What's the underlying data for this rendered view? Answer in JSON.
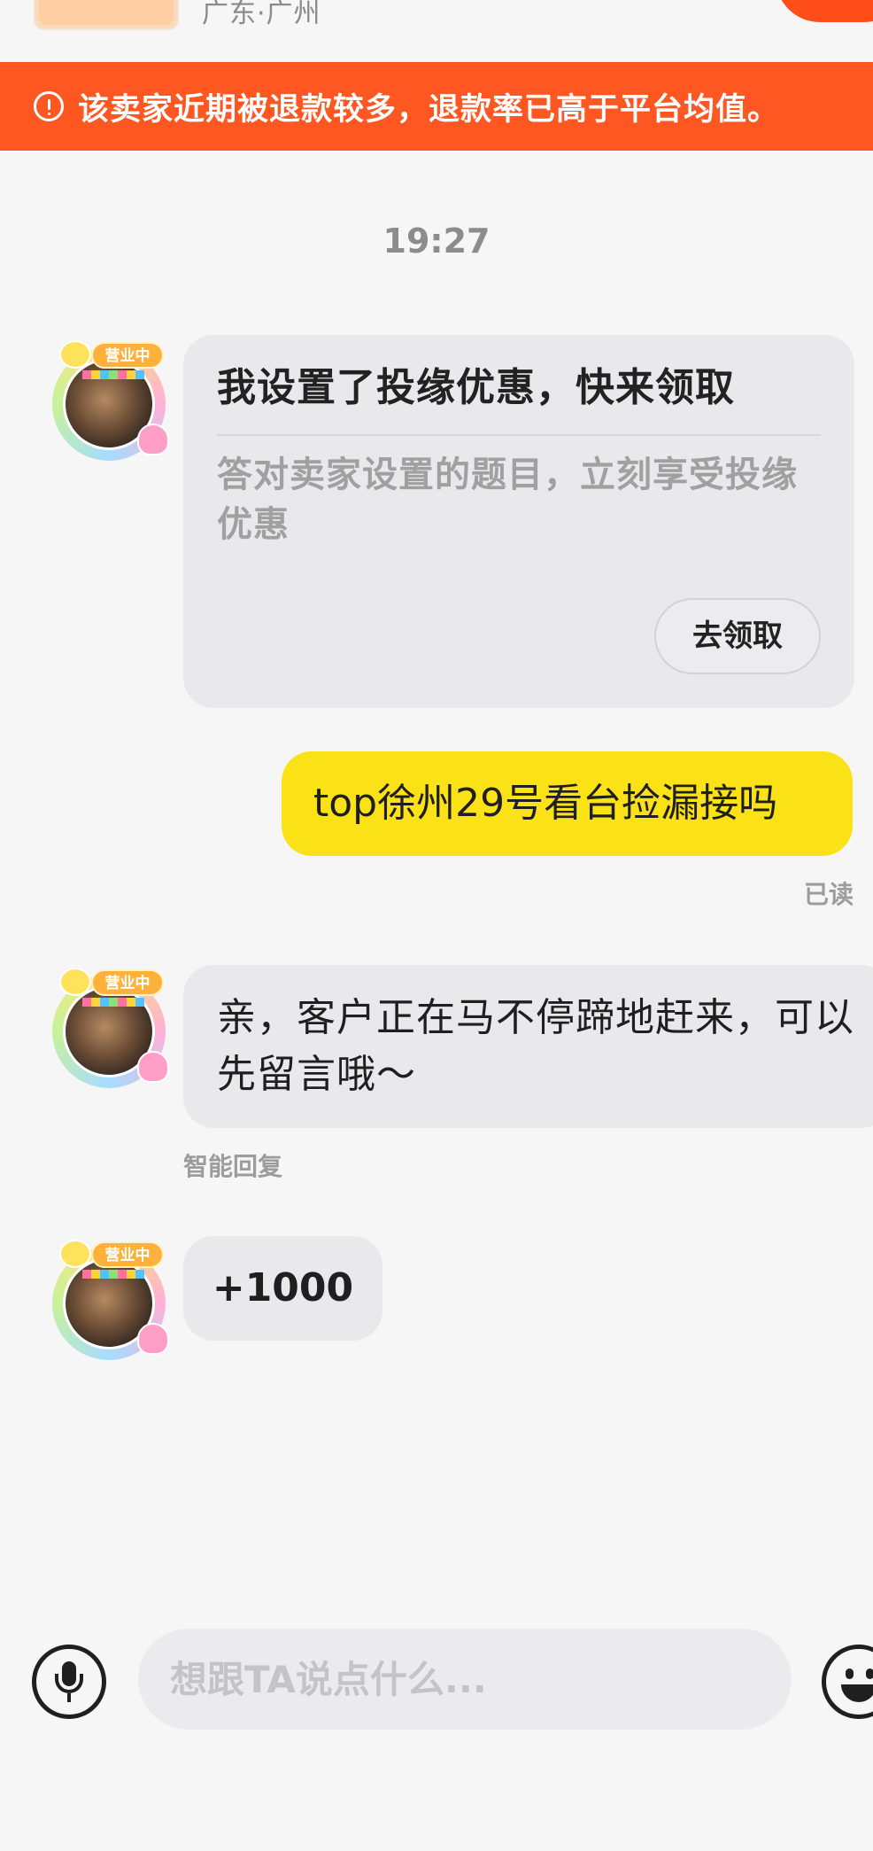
{
  "header": {
    "location": "广东·广州"
  },
  "warning": {
    "text": "该卖家近期被退款较多，退款率已高于平台均值。"
  },
  "chat": {
    "timestamp": "19:27",
    "seller_badge": "营业中",
    "coupon": {
      "title": "我设置了投缘优惠，快来领取",
      "description": "答对卖家设置的题目，立刻享受投缘优惠",
      "button_label": "去领取"
    },
    "outgoing_message": {
      "text": "top徐州29号看台捡漏接吗",
      "status": "已读"
    },
    "auto_reply": {
      "text": "亲，客户正在马不停蹄地赶来，可以先留言哦～",
      "label": "智能回复"
    },
    "seller_message": {
      "text": "+1000"
    }
  },
  "input_bar": {
    "placeholder": "想跟TA说点什么..."
  },
  "colors": {
    "warning_banner": "#ff5722",
    "outgoing_bubble": "#fbe216",
    "incoming_bubble": "#e9e9eb",
    "background": "#f6f6f6"
  },
  "icons": {
    "warning": "exclamation-circle-icon",
    "voice": "microphone-icon",
    "emoji": "smiley-face-icon"
  }
}
